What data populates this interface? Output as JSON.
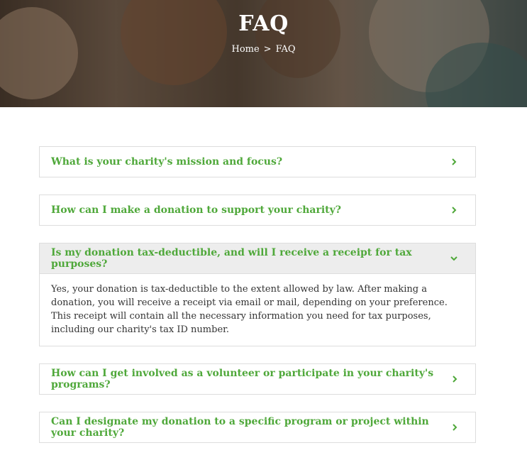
{
  "hero": {
    "title": "FAQ",
    "breadcrumb": {
      "home": "Home",
      "separator": ">",
      "current": "FAQ"
    }
  },
  "accent_color": "#4fa83a",
  "faqs": [
    {
      "question": "What is your charity's mission and focus?",
      "expanded": false
    },
    {
      "question": "How can I make a donation to support your charity?",
      "expanded": false
    },
    {
      "question": "Is my donation tax-deductible, and will I receive a receipt for tax purposes?",
      "expanded": true,
      "answer": "Yes, your donation is tax-deductible to the extent allowed by law. After making a donation, you will receive a receipt via email or mail, depending on your preference. This receipt will contain all the necessary information you need for tax purposes, including our charity's tax ID number."
    },
    {
      "question": "How can I get involved as a volunteer or participate in your charity's programs?",
      "expanded": false
    },
    {
      "question": "Can I designate my donation to a specific program or project within your charity?",
      "expanded": false
    }
  ]
}
